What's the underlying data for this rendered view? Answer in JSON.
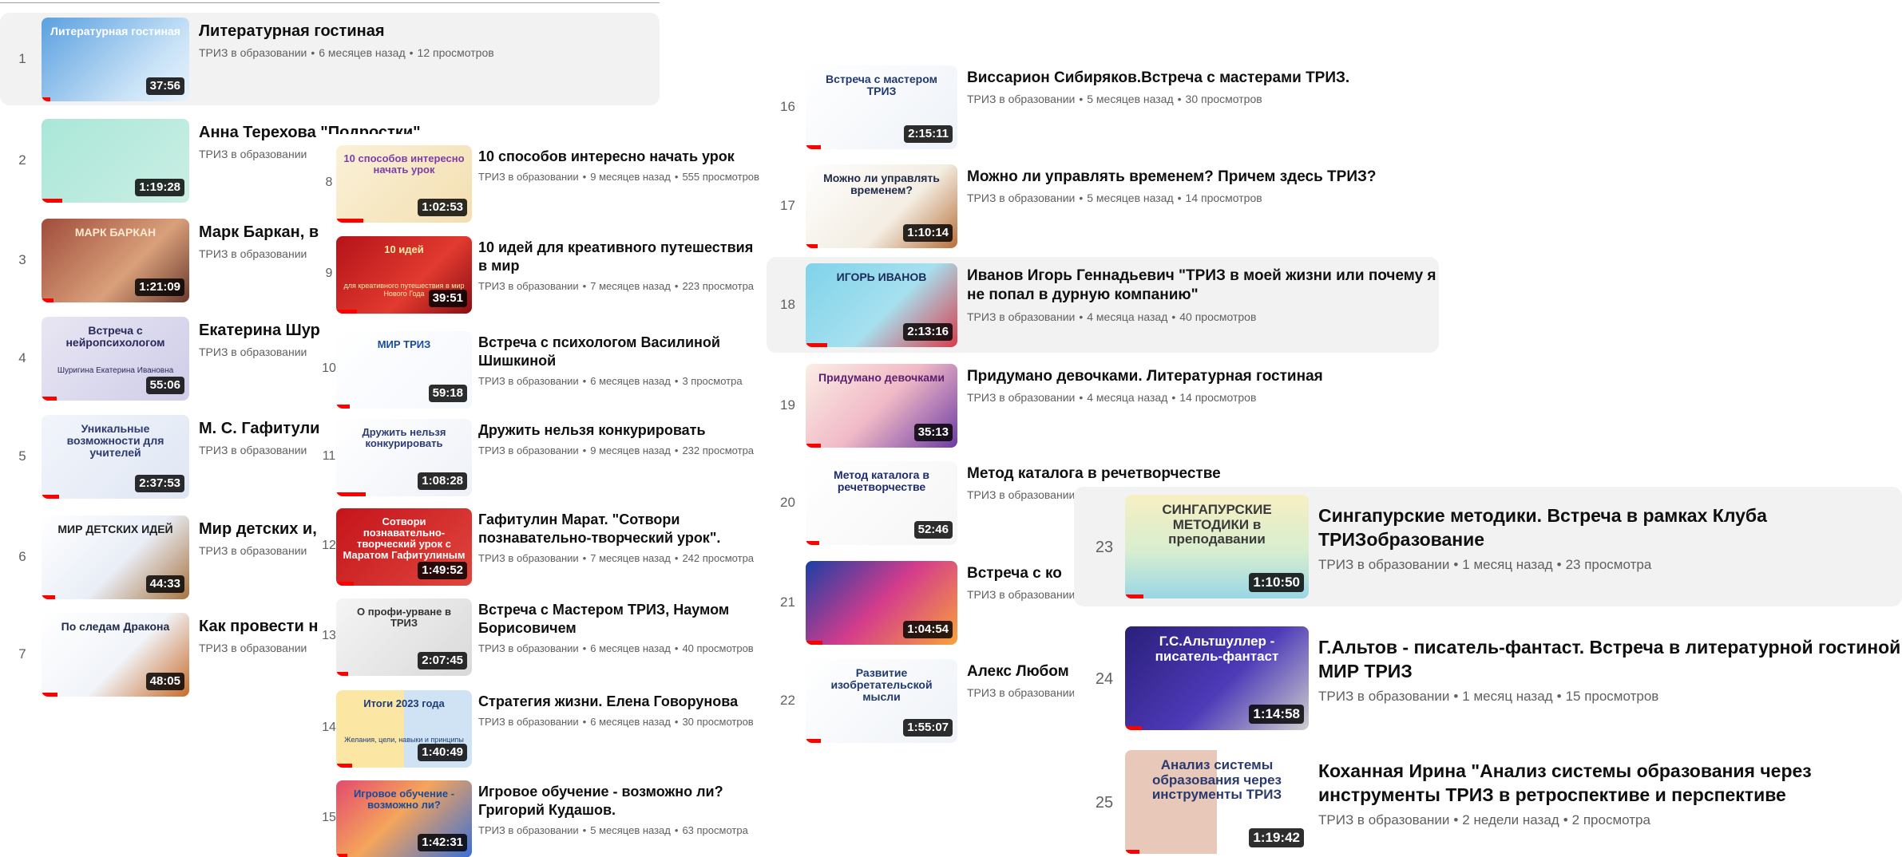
{
  "channel": "ТРИЗ в образовании",
  "col1": [
    {
      "n": "1",
      "title": "Литературная гостиная",
      "age": "6 месяцев назад",
      "views": "12 просмотров",
      "dur": "37:56",
      "thumb": "Литературная гостиная",
      "tsub": "",
      "bg": "linear-gradient(135deg,#5aa0e0,#c9e3f7 70%,#e8f2fb)",
      "fg": "#ffffff",
      "prog": 6
    },
    {
      "n": "2",
      "title": "Анна Терехова \"Подростки\"",
      "age": "",
      "views": "",
      "dur": "1:19:28",
      "thumb": "",
      "tsub": "",
      "bg": "linear-gradient(135deg,#a9e7d8,#cbeee4)",
      "fg": "#0a5a50",
      "prog": 14
    },
    {
      "n": "3",
      "title": "Марк Баркан, в",
      "age": "",
      "views": "",
      "dur": "1:21:09",
      "thumb": "МАРК БАРКАН",
      "tsub": "",
      "bg": "linear-gradient(135deg,#a04c3c,#d9a07a 60%,#6b3a2e)",
      "fg": "#ffe9d0",
      "prog": 8
    },
    {
      "n": "4",
      "title": "Екатерина Шур ТРИЗобразова",
      "age": "",
      "views": "",
      "dur": "55:06",
      "thumb": "Встреча с нейропсихологом",
      "tsub": "Шуригина Екатерина Ивановна",
      "bg": "linear-gradient(135deg,#e8e6f3,#cfcde8)",
      "fg": "#2a2a5a",
      "prog": 10
    },
    {
      "n": "5",
      "title": "М. С. Гафитули",
      "age": "",
      "views": "",
      "dur": "2:37:53",
      "thumb": "Уникальные возможности для учителей",
      "tsub": "",
      "bg": "linear-gradient(135deg,#f2f5fb,#dfe6f3)",
      "fg": "#2b3b70",
      "prog": 12
    },
    {
      "n": "6",
      "title": "Мир детских и,",
      "age": "",
      "views": "",
      "dur": "44:33",
      "thumb": "МИР ДЕТСКИХ ИДЕЙ",
      "tsub": "",
      "bg": "linear-gradient(135deg,#ffffff,#e9eef7 55%,#a7733f)",
      "fg": "#222222",
      "prog": 9
    },
    {
      "n": "7",
      "title": "Как провести н инструментов",
      "age": "",
      "views": "",
      "dur": "48:05",
      "thumb": "По следам Дракона",
      "tsub": "",
      "bg": "linear-gradient(135deg,#ffffff,#f1f4f9 55%,#c76c2c)",
      "fg": "#1f2a4a",
      "prog": 11
    }
  ],
  "col2": [
    {
      "n": "8",
      "title": "10 способов интересно начать урок",
      "age": "9 месяцев назад",
      "views": "555 просмотров",
      "dur": "1:02:53",
      "thumb": "10 способов интересно начать урок",
      "tsub": "",
      "bg": "linear-gradient(135deg,#fbf1d8,#f3dfb0)",
      "fg": "#7b3ea8",
      "prog": 20
    },
    {
      "n": "9",
      "title": "10 идей для креативного путешествия в мир",
      "age": "7 месяцев назад",
      "views": "223 просмотра",
      "dur": "39:51",
      "thumb": "10 идей",
      "tsub": "для креативного путешествия в мир Нового Года",
      "bg": "linear-gradient(135deg,#b4131a,#e23a2f 60%,#8a0e12)",
      "fg": "#ffe9a6",
      "prog": 15
    },
    {
      "n": "10",
      "title": "Встреча с психологом Василиной Шишкиной",
      "age": "6 месяцев назад",
      "views": "3 просмотра",
      "dur": "59:18",
      "thumb": "МИР ТРИЗ",
      "tsub": "",
      "bg": "linear-gradient(135deg,#ffffff,#f4f7fc)",
      "fg": "#1a4b9a",
      "prog": 10
    },
    {
      "n": "11",
      "title": "Дружить нельзя конкурировать",
      "age": "9 месяцев назад",
      "views": "232 просмотра",
      "dur": "1:08:28",
      "thumb": "Дружить нельзя конкурировать",
      "tsub": "",
      "bg": "linear-gradient(135deg,#ffffff,#eef1f8)",
      "fg": "#2c3b74",
      "prog": 22
    },
    {
      "n": "12",
      "title": "Гафитулин Марат. \"Сотвори познавательно-творческий урок\". Открытая встреча от МИР ТРИЗ.",
      "age": "7 месяцев назад",
      "views": "242 просмотра",
      "dur": "1:49:52",
      "thumb": "Сотвори познавательно-творческий урок с Маратом Гафитулиным",
      "tsub": "",
      "bg": "linear-gradient(135deg,#c5141b,#e0463d)",
      "fg": "#ffffff",
      "prog": 13
    },
    {
      "n": "13",
      "title": "Встреча с Мастером ТРИЗ, Наумом Борисовичем",
      "age": "6 месяцев назад",
      "views": "40 просмотров",
      "dur": "2:07:45",
      "thumb": "О профи-урване в ТРИЗ",
      "tsub": "",
      "bg": "linear-gradient(135deg,#f5f5f5,#d9d9d9)",
      "fg": "#333333",
      "prog": 9
    },
    {
      "n": "14",
      "title": "Стратегия жизни. Елена Говорунова",
      "age": "6 месяцев назад",
      "views": "30 просмотров",
      "dur": "1:40:49",
      "thumb": "Итоги 2023 года",
      "tsub": "Желания, цели, навыки и принципы",
      "bg": "linear-gradient(90deg,#fbe6a3 50%,#cfe3f5 50%)",
      "fg": "#1e3d78",
      "prog": 12
    },
    {
      "n": "15",
      "title": "Игровое обучение - возможно ли? Григорий Кудашов.",
      "age": "5 месяцев назад",
      "views": "63 просмотра",
      "dur": "1:42:31",
      "thumb": "Игровое обучение - возможно ли?",
      "tsub": "",
      "bg": "linear-gradient(135deg,#e34a6f,#f5a55b 45%,#3a6fd8)",
      "fg": "#1a4a9a",
      "prog": 8
    }
  ],
  "col3": [
    {
      "n": "16",
      "title": "Виссарион Сибиряков.Встреча с мастерами ТРИЗ.",
      "age": "5 месяцев назад",
      "views": "30 просмотров",
      "dur": "2:15:11",
      "thumb": "Встреча с мастером ТРИЗ",
      "tsub": "",
      "bg": "linear-gradient(135deg,#ffffff,#eef2f8)",
      "fg": "#203a6e",
      "prog": 10
    },
    {
      "n": "17",
      "title": "Можно ли управлять временем? Причем здесь ТРИЗ?",
      "age": "5 месяцев назад",
      "views": "14 просмотров",
      "dur": "1:10:14",
      "thumb": "Можно ли управлять временем?",
      "tsub": "",
      "bg": "linear-gradient(135deg,#ffffff,#f3ede2 60%,#b86f39)",
      "fg": "#1e2a48",
      "prog": 8
    },
    {
      "n": "18",
      "title": "Иванов Игорь Геннадьевич \"ТРИЗ в моей жизни или почему я не попал в дурную компанию\"",
      "age": "4 месяца назад",
      "views": "40 просмотров",
      "dur": "2:13:16",
      "thumb": "ИГОРЬ ИВАНОВ",
      "tsub": "",
      "bg": "linear-gradient(135deg,#7fd3ea,#a6e0ef 55%,#d93c4a)",
      "fg": "#1c2c5a",
      "prog": 14
    },
    {
      "n": "19",
      "title": "Придумано девочками. Литературная гостиная",
      "age": "4 месяца назад",
      "views": "14 просмотров",
      "dur": "35:13",
      "thumb": "Придумано девочками",
      "tsub": "",
      "bg": "linear-gradient(135deg,#fbeee6,#f0b9c6 50%,#6c3aa4)",
      "fg": "#5a1f6e",
      "prog": 10
    },
    {
      "n": "20",
      "title": "Метод каталога в речетворчестве",
      "age": "",
      "views": "",
      "dur": "52:46",
      "thumb": "Метод каталога в речетворчестве",
      "tsub": "",
      "bg": "linear-gradient(135deg,#ffffff,#f5f5f5)",
      "fg": "#1c2c6e",
      "prog": 9
    },
    {
      "n": "21",
      "title": "Встреча с ко",
      "age": "",
      "views": "",
      "dur": "1:04:54",
      "thumb": "",
      "tsub": "",
      "bg": "linear-gradient(135deg,#1b3fa6,#d53c8c 50%,#f8a23a)",
      "fg": "#ffffff",
      "prog": 11
    },
    {
      "n": "22",
      "title": "Алекс Любом",
      "age": "",
      "views": "",
      "dur": "1:55:07",
      "thumb": "Развитие изобретательской мысли",
      "tsub": "",
      "bg": "linear-gradient(135deg,#ffffff,#eef2f8)",
      "fg": "#203a6e",
      "prog": 10
    }
  ],
  "col4": [
    {
      "n": "23",
      "title": "Сингапурские методики. Встреча в рамках Клуба ТРИЗобразование",
      "age": "1 месяц назад",
      "views": "23 просмотра",
      "dur": "1:10:50",
      "thumb": "СИНГАПУРСКИЕ МЕТОДИКИ в преподавании",
      "tsub": "",
      "bg": "linear-gradient(180deg,#f7efc2,#d7eecf 55%,#99d6e6)",
      "fg": "#3a3a3a",
      "prog": 10
    },
    {
      "n": "24",
      "title": "Г.Альтов - писатель-фантаст. Встреча в литературной гостиной МИР ТРИЗ",
      "age": "1 месяц назад",
      "views": "15 просмотров",
      "dur": "1:14:58",
      "thumb": "Г.С.Альтшуллер - писатель-фантаст",
      "tsub": "",
      "bg": "linear-gradient(135deg,#2a1f7a,#4d3ab8 55%,#cfcfcf)",
      "fg": "#ffffff",
      "prog": 9
    },
    {
      "n": "25",
      "title": "Коханная Ирина \"Анализ системы образования через инструменты ТРИЗ в ретроспективе и перспективе",
      "age": "2 недели назад",
      "views": "2 просмотра",
      "dur": "1:19:42",
      "thumb": "Анализ системы образования через инструменты ТРИЗ",
      "tsub": "",
      "bg": "linear-gradient(90deg,#e8c8b9 50%,#ffffff 50%)",
      "fg": "#2b3a6e",
      "prog": 8
    }
  ]
}
